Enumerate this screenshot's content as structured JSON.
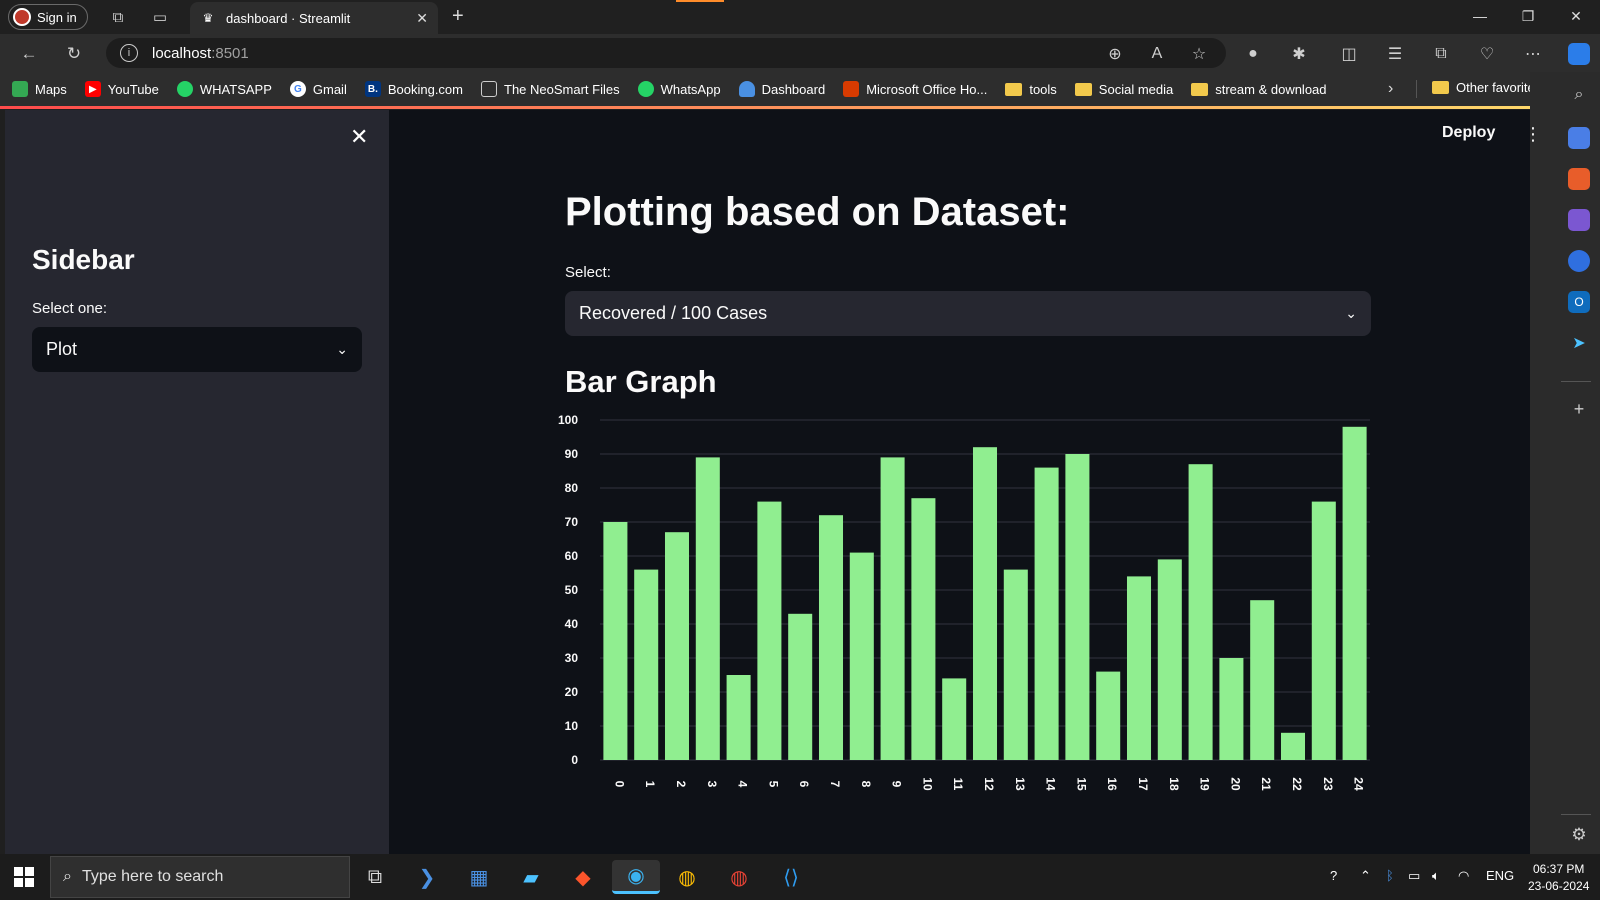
{
  "browser": {
    "signin_label": "Sign in",
    "tab_title": "dashboard · Streamlit",
    "url_host": "localhost",
    "url_port": ":8501",
    "favorites": [
      {
        "label": "Maps",
        "icon": "maps-icon",
        "color": "#34a853"
      },
      {
        "label": "YouTube",
        "icon": "youtube-icon",
        "color": "#ff0000"
      },
      {
        "label": "WHATSAPP",
        "icon": "whatsapp-icon",
        "color": "#25d366"
      },
      {
        "label": "Gmail",
        "icon": "google-icon",
        "color": "#ffffff"
      },
      {
        "label": "Booking.com",
        "icon": "booking-icon",
        "color": "#003580"
      },
      {
        "label": "The NeoSmart Files",
        "icon": "page-icon",
        "color": "#2d2d2d"
      },
      {
        "label": "WhatsApp",
        "icon": "whatsapp-icon",
        "color": "#25d366"
      },
      {
        "label": "Dashboard",
        "icon": "cloud-icon",
        "color": "#4a90e2"
      },
      {
        "label": "Microsoft Office Ho...",
        "icon": "office-icon",
        "color": "#d83b01"
      },
      {
        "label": "tools",
        "icon": "folder-icon",
        "color": "#f2c94c"
      },
      {
        "label": "Social media",
        "icon": "folder-icon",
        "color": "#f2c94c"
      },
      {
        "label": "stream & download",
        "icon": "folder-icon",
        "color": "#f2c94c"
      }
    ],
    "other_favorites": "Other favorites"
  },
  "app": {
    "header": {
      "deploy_label": "Deploy"
    },
    "sidebar": {
      "title": "Sidebar",
      "select_label": "Select one:",
      "select_value": "Plot"
    },
    "main": {
      "title": "Plotting based on Dataset:",
      "select_label": "Select:",
      "select_value": "Recovered / 100 Cases",
      "chart_title": "Bar Graph"
    }
  },
  "chart_data": {
    "type": "bar",
    "categories": [
      "0",
      "1",
      "2",
      "3",
      "4",
      "5",
      "6",
      "7",
      "8",
      "9",
      "10",
      "11",
      "12",
      "13",
      "14",
      "15",
      "16",
      "17",
      "18",
      "19",
      "20",
      "21",
      "22",
      "23",
      "24"
    ],
    "values": [
      70,
      56,
      67,
      89,
      25,
      76,
      43,
      72,
      61,
      89,
      77,
      24,
      92,
      56,
      86,
      90,
      26,
      54,
      59,
      87,
      30,
      47,
      8,
      76,
      98
    ],
    "title": "",
    "xlabel": "",
    "ylabel": "",
    "ylim": [
      0,
      100
    ],
    "yticks": [
      0,
      10,
      20,
      30,
      40,
      50,
      60,
      70,
      80,
      90,
      100
    ],
    "bar_color": "#90ee90",
    "grid": true
  },
  "taskbar": {
    "search_placeholder": "Type here to search",
    "tray_lang": "ENG",
    "time": "06:37 PM",
    "date": "23-06-2024"
  }
}
